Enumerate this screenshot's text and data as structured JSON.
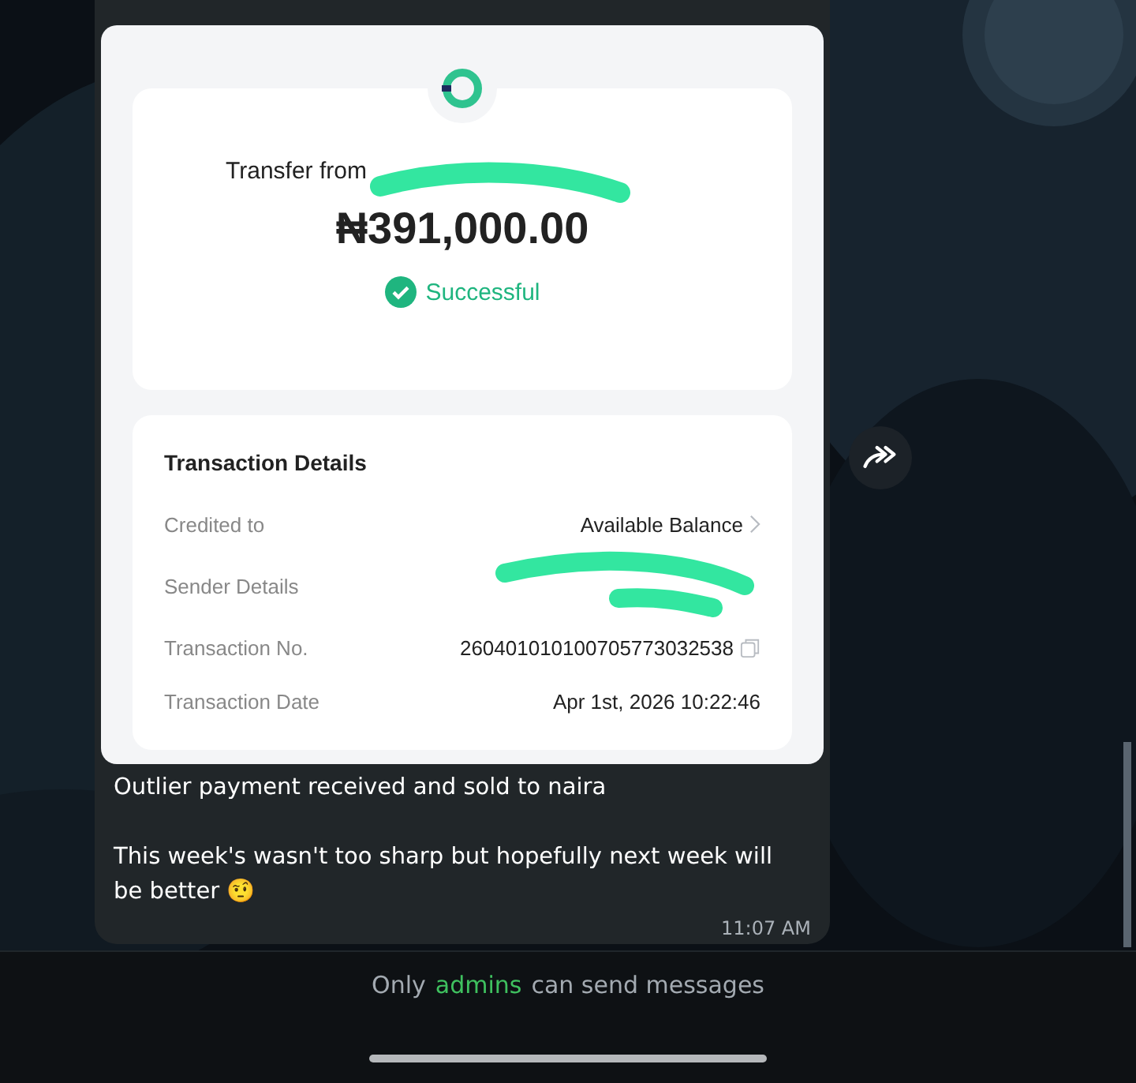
{
  "receipt": {
    "title": "Transfer from",
    "amount": "₦391,000.00",
    "status": "Successful",
    "details_title": "Transaction Details",
    "details": [
      {
        "label": "Credited to",
        "value": "Available Balance",
        "kind": "link"
      },
      {
        "label": "Sender Details",
        "kind": "redacted"
      },
      {
        "label": "Transaction No.",
        "value": "260401010100705773032538",
        "kind": "copy"
      },
      {
        "label": "Transaction Date",
        "value": "Apr 1st, 2026 10:22:46",
        "kind": "plain"
      }
    ]
  },
  "message": {
    "paragraphs": [
      "Outlier payment received and sold to naira",
      "This week's wasn't too sharp but hopefully next week will be better 🤨"
    ],
    "time": "11:07 AM"
  },
  "footer": {
    "parts": [
      {
        "text": "Only",
        "highlight": false
      },
      {
        "text": "admins",
        "highlight": true
      },
      {
        "text": "can send messages",
        "highlight": false
      }
    ]
  }
}
